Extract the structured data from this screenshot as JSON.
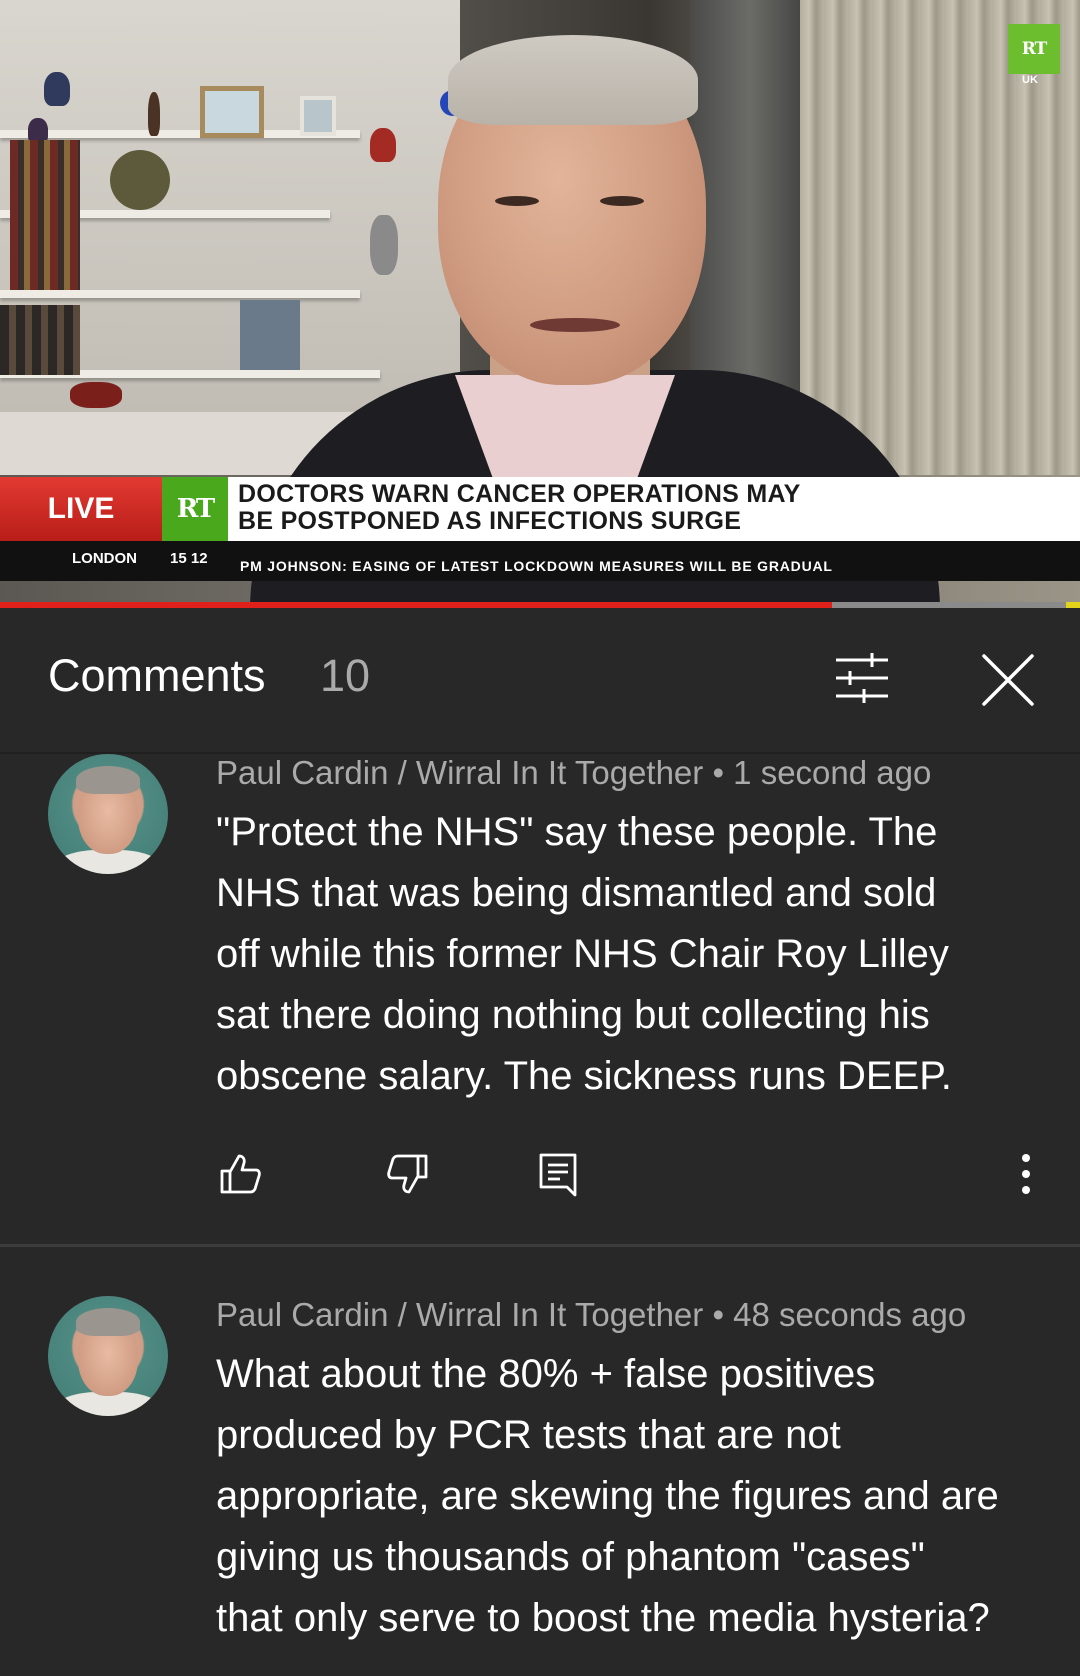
{
  "video": {
    "channel_logo": "RT",
    "channel_region": "UK",
    "live_label": "LIVE",
    "bug_logo": "RT",
    "headline_line1": "DOCTORS WARN CANCER OPERATIONS MAY",
    "headline_line2": "BE POSTPONED AS INFECTIONS SURGE",
    "ticker_location": "LONDON",
    "ticker_time": "15 12",
    "ticker_text": "PM JOHNSON: EASING OF LATEST LOCKDOWN MEASURES WILL BE GRADUAL",
    "progress_fraction": 0.77,
    "colors": {
      "progress": "#e0201b",
      "rt_green": "#4aa81c",
      "live_red": "#d12a24"
    }
  },
  "comments_panel": {
    "title": "Comments",
    "count": "10",
    "filter_icon": "sort-filter-icon",
    "close_icon": "close-icon"
  },
  "comments": [
    {
      "author": "Paul Cardin / Wirral In It Together",
      "separator": "•",
      "time": "1 second ago",
      "lines": [
        "\"Protect the NHS\" say these people. The",
        "NHS that was being dismantled and sold",
        "off while this former NHS Chair Roy Lilley",
        "sat there doing nothing but collecting his",
        "obscene salary. The sickness runs DEEP."
      ]
    },
    {
      "author": "Paul Cardin / Wirral In It Together",
      "separator": "•",
      "time": "48 seconds ago",
      "lines": [
        "What about the 80% + false positives",
        "produced by PCR tests that are not",
        "appropriate, are skewing the figures and are",
        "giving us thousands of phantom \"cases\"",
        "that only serve to boost the media hysteria?"
      ]
    }
  ]
}
